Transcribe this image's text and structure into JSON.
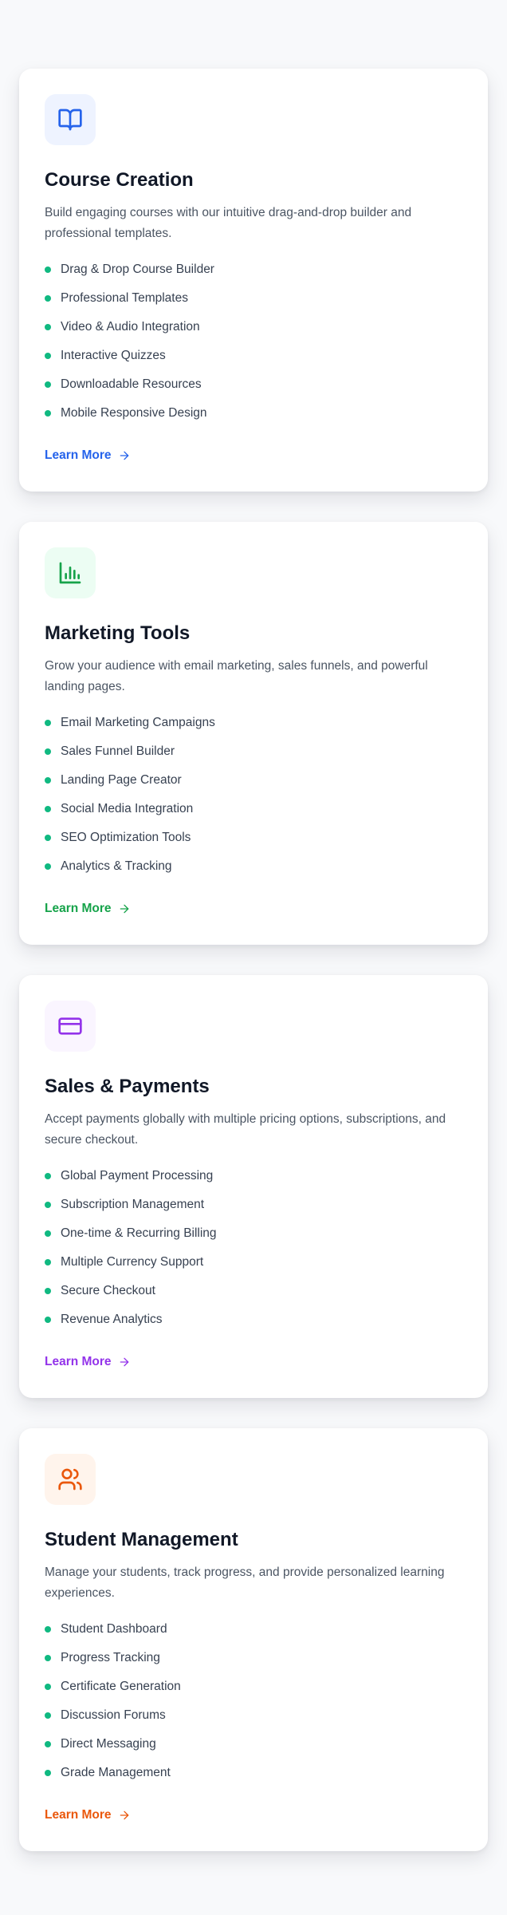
{
  "cards": [
    {
      "icon": "book-open-icon",
      "title": "Course Creation",
      "description": "Build engaging courses with our intuitive drag-and-drop builder and professional templates.",
      "features": [
        "Drag & Drop Course Builder",
        "Professional Templates",
        "Video & Audio Integration",
        "Interactive Quizzes",
        "Downloadable Resources",
        "Mobile Responsive Design"
      ],
      "link": "Learn More",
      "accent": "#2563eb",
      "icon_bg": "#eef3ff"
    },
    {
      "icon": "bar-chart-icon",
      "title": "Marketing Tools",
      "description": "Grow your audience with email marketing, sales funnels, and powerful landing pages.",
      "features": [
        "Email Marketing Campaigns",
        "Sales Funnel Builder",
        "Landing Page Creator",
        "Social Media Integration",
        "SEO Optimization Tools",
        "Analytics & Tracking"
      ],
      "link": "Learn More",
      "accent": "#16a34a",
      "icon_bg": "#ecfdf3"
    },
    {
      "icon": "credit-card-icon",
      "title": "Sales & Payments",
      "description": "Accept payments globally with multiple pricing options, subscriptions, and secure checkout.",
      "features": [
        "Global Payment Processing",
        "Subscription Management",
        "One-time & Recurring Billing",
        "Multiple Currency Support",
        "Secure Checkout",
        "Revenue Analytics"
      ],
      "link": "Learn More",
      "accent": "#9333ea",
      "icon_bg": "#faf5ff"
    },
    {
      "icon": "users-icon",
      "title": "Student Management",
      "description": "Manage your students, track progress, and provide personalized learning experiences.",
      "features": [
        "Student Dashboard",
        "Progress Tracking",
        "Certificate Generation",
        "Discussion Forums",
        "Direct Messaging",
        "Grade Management"
      ],
      "link": "Learn More",
      "accent": "#ea580c",
      "icon_bg": "#fff4ec"
    }
  ],
  "bullet_color": "#10b981"
}
